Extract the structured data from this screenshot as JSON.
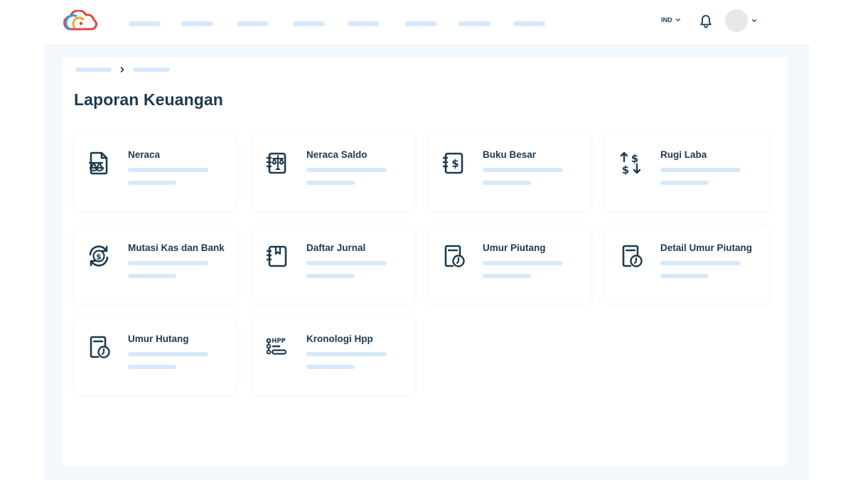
{
  "header": {
    "language": "IND",
    "nav_placeholder_count": 8
  },
  "page": {
    "title": "Laporan Keuangan"
  },
  "reports": [
    {
      "label": "Neraca",
      "icon": "balance-scale-document-icon"
    },
    {
      "label": "Neraca Saldo",
      "icon": "balance-notebook-icon"
    },
    {
      "label": "Buku Besar",
      "icon": "ledger-dollar-icon"
    },
    {
      "label": "Rugi Laba",
      "icon": "profit-loss-arrows-icon"
    },
    {
      "label": "Mutasi Kas dan Bank",
      "icon": "cash-exchange-icon"
    },
    {
      "label": "Daftar Jurnal",
      "icon": "journal-notebook-icon"
    },
    {
      "label": "Umur Piutang",
      "icon": "receivable-aging-clock-icon"
    },
    {
      "label": "Detail Umur Piutang",
      "icon": "receivable-aging-detail-icon"
    },
    {
      "label": "Umur Hutang",
      "icon": "payable-aging-clock-icon"
    },
    {
      "label": "Kronologi Hpp",
      "icon": "hpp-timeline-icon"
    }
  ],
  "colors": {
    "text": "#1d3a4f",
    "placeholder": "#d6e9fa",
    "page_bg": "#f3f8fd",
    "logo_blue": "#2b9fe0",
    "logo_orange": "#f4a52a",
    "logo_red": "#e2463e"
  }
}
